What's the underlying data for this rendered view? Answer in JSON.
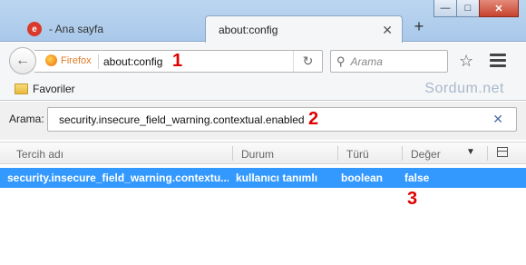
{
  "window": {
    "minimize_icon": "minimize-icon",
    "maximize_icon": "maximize-icon",
    "close_icon": "close-icon"
  },
  "tabs": [
    {
      "title": "- Ana sayfa",
      "icon": "site-logo-icon"
    },
    {
      "title": "about:config"
    }
  ],
  "toolbar": {
    "identity_label": "Firefox",
    "url": "about:config",
    "search_placeholder": "Arama"
  },
  "bookmarks": {
    "items": [
      {
        "label": "Favoriler"
      }
    ],
    "watermark": "Sordum.net"
  },
  "config": {
    "filter_label": "Arama:",
    "filter_value": "security.insecure_field_warning.contextual.enabled",
    "columns": [
      "Tercih adı",
      "Durum",
      "Türü",
      "Değer"
    ],
    "rows": [
      {
        "name": "security.insecure_field_warning.contextu...",
        "status": "kullanıcı tanımlı",
        "type": "boolean",
        "value": "false"
      }
    ]
  },
  "annotations": [
    "1",
    "2",
    "3"
  ],
  "colors": {
    "selection": "#3399ff",
    "marker": "#e00000",
    "accent": "#e07a23"
  }
}
